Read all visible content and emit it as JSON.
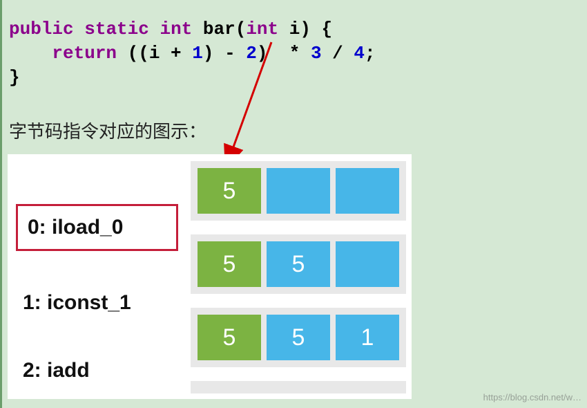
{
  "code": {
    "line1": {
      "kw_public": "public",
      "kw_static": "static",
      "kw_int": "int",
      "fn": "bar",
      "paren_open": "(",
      "param_type": "int",
      "param_name": " i",
      "paren_close": ")",
      "brace_open": " {"
    },
    "line2": {
      "indent": "    ",
      "kw_return": "return",
      "expr_a": " ((i + ",
      "num1": "1",
      "expr_b": ") - ",
      "num2": "2",
      "expr_c": ")",
      "expr_d": "* ",
      "num3": "3",
      "expr_e": " / ",
      "num4": "4",
      "semi": ";"
    },
    "line3": {
      "brace_close": "}"
    }
  },
  "caption": "字节码指令对应的图示：",
  "instructions": [
    {
      "label": "0: iload_0",
      "highlight": true
    },
    {
      "label": "1: iconst_1",
      "highlight": false
    },
    {
      "label": "2: iadd",
      "highlight": false
    }
  ],
  "stacks": [
    [
      {
        "value": "5",
        "color": "green"
      },
      {
        "value": "",
        "color": "blue"
      },
      {
        "value": "",
        "color": "blue"
      }
    ],
    [
      {
        "value": "5",
        "color": "green"
      },
      {
        "value": "5",
        "color": "blue"
      },
      {
        "value": "",
        "color": "blue"
      }
    ],
    [
      {
        "value": "5",
        "color": "green"
      },
      {
        "value": "5",
        "color": "blue"
      },
      {
        "value": "1",
        "color": "blue"
      }
    ]
  ],
  "watermark": "https://blog.csdn.net/w…"
}
